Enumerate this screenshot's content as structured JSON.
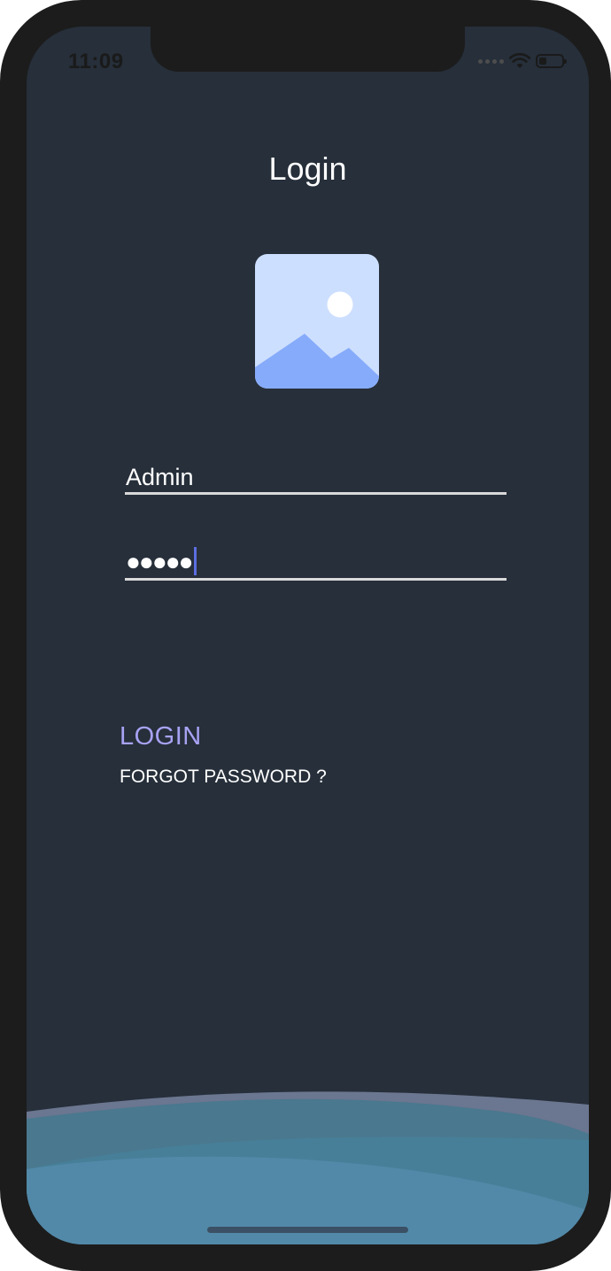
{
  "status_bar": {
    "time": "11:09",
    "battery_level": 0.35
  },
  "header": {
    "title": "Login"
  },
  "logo": {
    "icon": "image-placeholder-icon",
    "colors": {
      "background": "#cddfff",
      "mountain": "#86abfb",
      "sun": "#ffffff"
    }
  },
  "form": {
    "username_value": "Admin",
    "password_mask": "●●●●●"
  },
  "actions": {
    "login_label": "LOGIN",
    "forgot_label": "FORGOT PASSWORD ?"
  },
  "colors": {
    "background": "#262f3a",
    "accent": "#a8a2f4",
    "caret": "#5b6ee1"
  }
}
